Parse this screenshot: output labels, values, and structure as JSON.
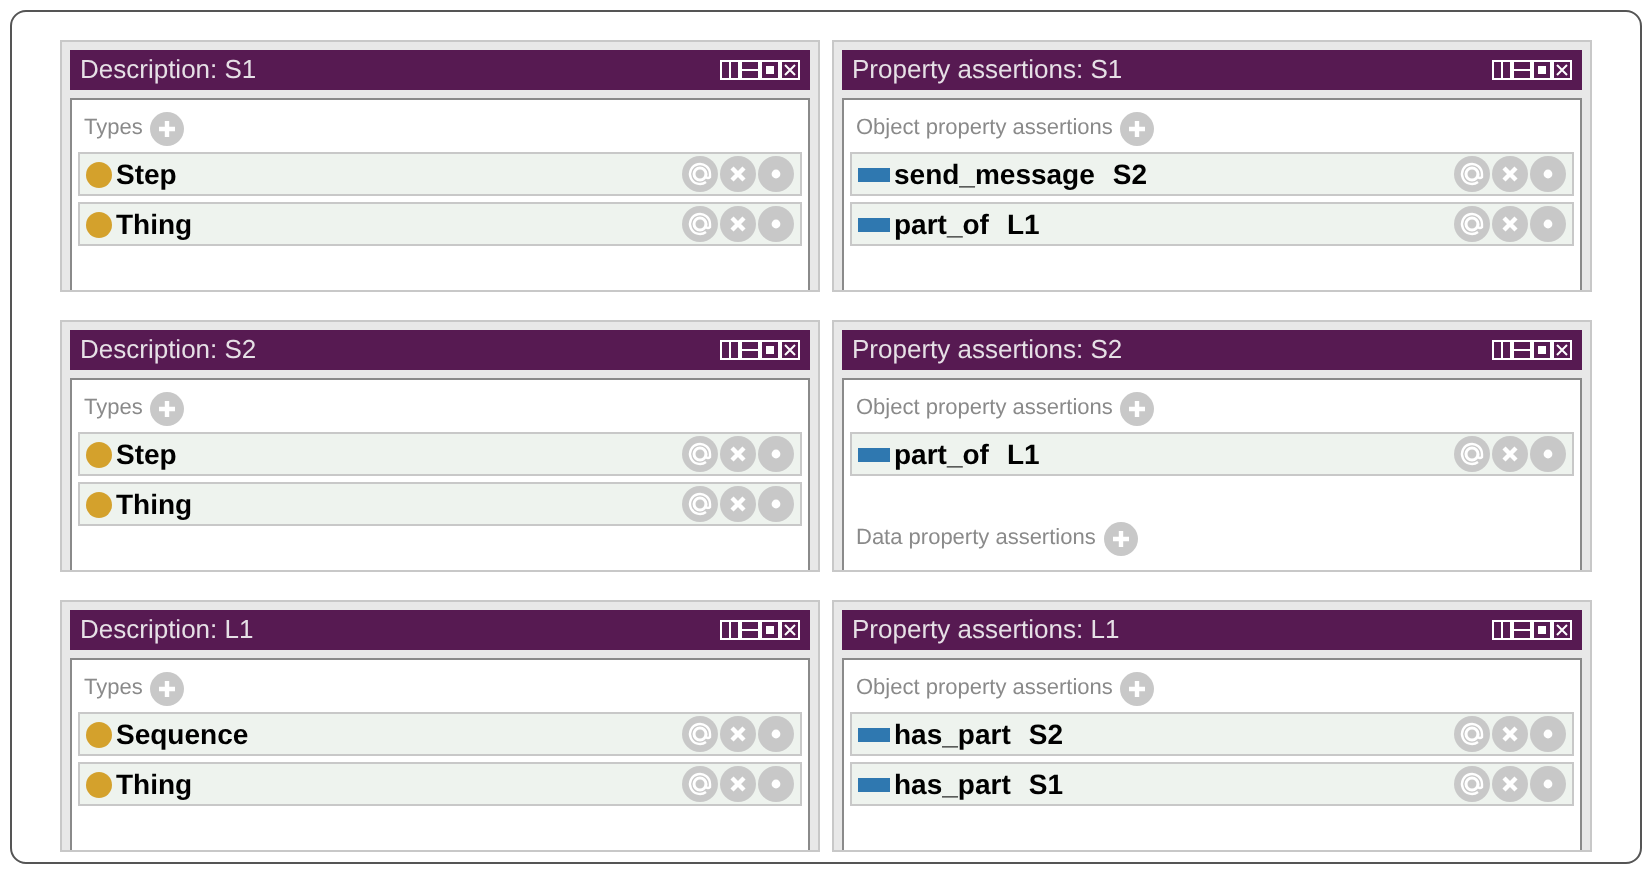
{
  "strips": [
    {
      "panels": [
        {
          "title": "Description: S1",
          "sections": [
            {
              "label": "Types",
              "items": [
                {
                  "kind": "class",
                  "name": "Step"
                },
                {
                  "kind": "class",
                  "name": "Thing"
                }
              ]
            }
          ]
        },
        {
          "title": "Property assertions: S1",
          "sections": [
            {
              "label": "Object property assertions",
              "items": [
                {
                  "kind": "property",
                  "name": "send_message",
                  "value": "S2"
                },
                {
                  "kind": "property",
                  "name": "part_of",
                  "value": "L1"
                }
              ]
            }
          ]
        }
      ]
    },
    {
      "panels": [
        {
          "title": "Description: S2",
          "sections": [
            {
              "label": "Types",
              "items": [
                {
                  "kind": "class",
                  "name": "Step"
                },
                {
                  "kind": "class",
                  "name": "Thing"
                }
              ]
            }
          ]
        },
        {
          "title": "Property assertions: S2",
          "sections": [
            {
              "label": "Object property assertions",
              "items": [
                {
                  "kind": "property",
                  "name": "part_of",
                  "value": "L1"
                }
              ]
            },
            {
              "label": "Data property assertions"
            }
          ]
        }
      ]
    },
    {
      "panels": [
        {
          "title": "Description: L1",
          "sections": [
            {
              "label": "Types",
              "items": [
                {
                  "kind": "class",
                  "name": "Sequence"
                },
                {
                  "kind": "class",
                  "name": "Thing"
                }
              ]
            }
          ]
        },
        {
          "title": "Property assertions: L1",
          "sections": [
            {
              "label": "Object property assertions",
              "items": [
                {
                  "kind": "property",
                  "name": "has_part",
                  "value": "S2"
                },
                {
                  "kind": "property",
                  "name": "has_part",
                  "value": "S1"
                }
              ]
            }
          ]
        }
      ]
    }
  ]
}
